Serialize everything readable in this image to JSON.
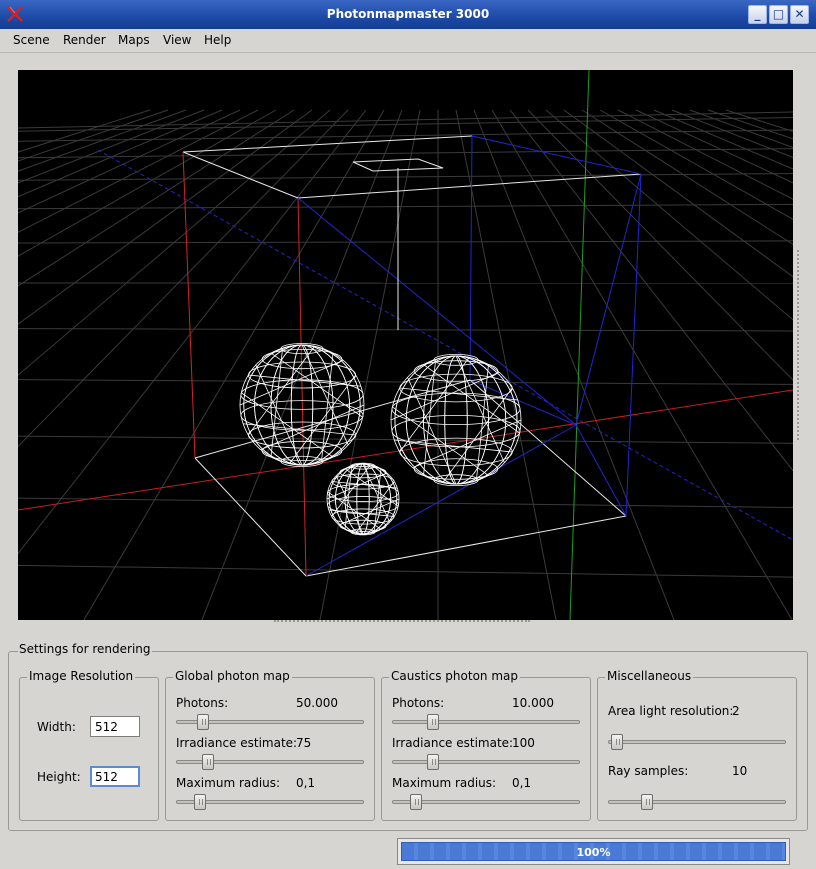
{
  "window": {
    "title": "Photonmapmaster 3000",
    "buttons": {
      "minimize": "_",
      "maximize": "□",
      "close": "✕"
    }
  },
  "menu": {
    "items": [
      "Scene",
      "Render",
      "Maps",
      "View",
      "Help"
    ]
  },
  "viewport": {
    "background": "#000000",
    "axis_colors": {
      "x": "#c81e1e",
      "y": "#1ea01e",
      "z": "#2424c8"
    }
  },
  "settings": {
    "title": "Settings for rendering",
    "image_resolution": {
      "title": "Image Resolution",
      "width_label": "Width:",
      "width_value": "512",
      "height_label": "Height:",
      "height_value": "512"
    },
    "global_photon_map": {
      "title": "Global photon map",
      "photons_label": "Photons:",
      "photons_value": "50.000",
      "photons_slider": 0.12,
      "irradiance_label": "Irradiance estimate:",
      "irradiance_value": "75",
      "irradiance_slider": 0.15,
      "radius_label": "Maximum radius:",
      "radius_value": "0,1",
      "radius_slider": 0.1
    },
    "caustics_photon_map": {
      "title": "Caustics photon map",
      "photons_label": "Photons:",
      "photons_value": "10.000",
      "photons_slider": 0.2,
      "irradiance_label": "Irradiance estimate:",
      "irradiance_value": "100",
      "irradiance_slider": 0.2,
      "radius_label": "Maximum radius:",
      "radius_value": "0,1",
      "radius_slider": 0.1
    },
    "miscellaneous": {
      "title": "Miscellaneous",
      "area_light_label": "Area light resolution:",
      "area_light_value": "2",
      "area_light_slider": 0.02,
      "ray_samples_label": "Ray samples:",
      "ray_samples_value": "10",
      "ray_samples_slider": 0.2
    }
  },
  "progress": {
    "text": "100%",
    "value": 1.0
  }
}
